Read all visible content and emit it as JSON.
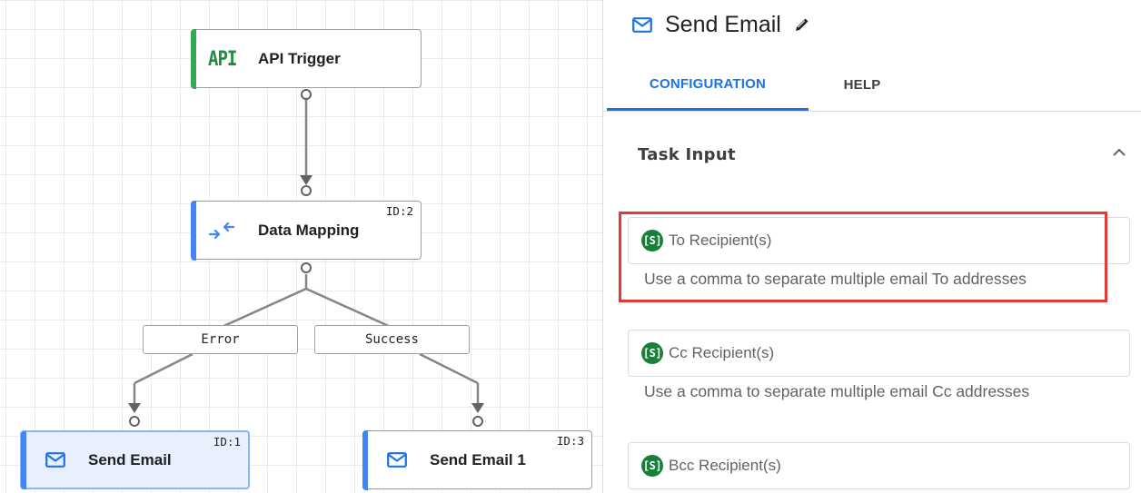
{
  "canvas": {
    "nodes": {
      "api_trigger": {
        "title": "API Trigger",
        "icon": "api-icon",
        "icon_text": "API",
        "accent": "#34a853"
      },
      "data_mapping": {
        "title": "Data Mapping",
        "id_label": "ID:2",
        "icon": "data-mapping-icon",
        "accent": "#4285f4"
      },
      "send_email": {
        "title": "Send Email",
        "id_label": "ID:1",
        "icon": "mail-icon",
        "accent": "#4285f4",
        "selected": true
      },
      "send_email_1": {
        "title": "Send Email 1",
        "id_label": "ID:3",
        "icon": "mail-icon",
        "accent": "#4285f4"
      }
    },
    "edge_labels": {
      "error": "Error",
      "success": "Success"
    }
  },
  "panel": {
    "title": "Send Email",
    "title_icon": "mail-icon",
    "edit_icon": "pencil-icon",
    "tabs": {
      "configuration": "CONFIGURATION",
      "help": "HELP"
    },
    "active_tab": "CONFIGURATION",
    "section": {
      "title": "Task Input",
      "expanded": true
    },
    "fields": {
      "to": {
        "badge": "[S]",
        "placeholder": "To Recipient(s)",
        "hint": "Use a comma to separate multiple email To addresses"
      },
      "cc": {
        "badge": "[S]",
        "placeholder": "Cc Recipient(s)",
        "hint": "Use a comma to separate multiple email Cc addresses"
      },
      "bcc": {
        "badge": "[S]",
        "placeholder": "Bcc Recipient(s)"
      }
    }
  },
  "colors": {
    "primary": "#1a73e8",
    "highlight": "#e53935",
    "string_badge": "#188038"
  }
}
